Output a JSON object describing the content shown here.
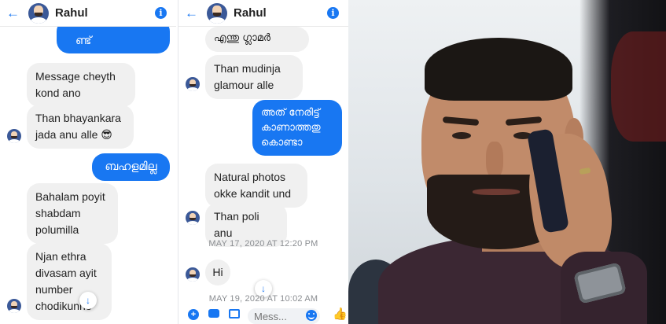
{
  "left_panel": {
    "contact_name": "Rahul",
    "messages": [
      {
        "dir": "out",
        "text": "ണ്ട്"
      },
      {
        "dir": "in",
        "text": "Message cheyth kond ano"
      },
      {
        "dir": "in",
        "text": "Than bhayankara jada anu alle 😎"
      },
      {
        "dir": "out",
        "text": "ബഹളമില്ല"
      },
      {
        "dir": "in",
        "text": "Bahalam poyit shabdam polumilla"
      },
      {
        "dir": "in",
        "text": "Njan ethra divasam ayit number chodikunno"
      }
    ]
  },
  "mid_panel": {
    "contact_name": "Rahul",
    "messages": [
      {
        "dir": "in",
        "text": "എന്തു ഗ്ലാമർ"
      },
      {
        "dir": "in",
        "text": "Than mudinja glamour alle"
      },
      {
        "dir": "out",
        "text": "അത് നേരിട്ട് കാണാത്തതു കൊണ്ടാ"
      },
      {
        "dir": "in",
        "text": "Natural photos okke kandit und"
      },
      {
        "dir": "in",
        "text": "Than poli anu"
      },
      {
        "dir": "in",
        "text": "Hi"
      }
    ],
    "timestamps": [
      "MAY 17, 2020 AT 12:20 PM",
      "MAY 19, 2020 AT 10:02 AM"
    ],
    "composer_placeholder": "Mess..."
  },
  "icons": {
    "back": "back-arrow-icon",
    "info": "info-icon",
    "scroll": "scroll-down-icon",
    "add": "plus-icon",
    "camera": "camera-icon",
    "gallery": "image-icon",
    "emoji": "emoji-icon",
    "like": "thumbs-up-icon"
  },
  "colors": {
    "accent": "#1877f2",
    "incoming_bubble": "#f0f0f0",
    "timestamp": "#8a8d91"
  }
}
